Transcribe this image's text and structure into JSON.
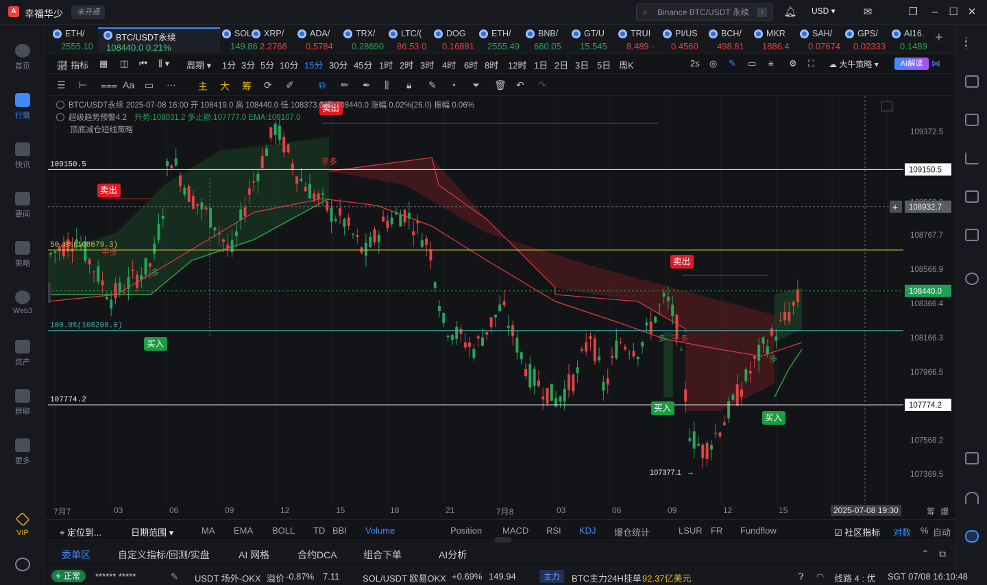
{
  "titlebar": {
    "app_title": "幸福华少",
    "login_status": "未开通",
    "search_placeholder": "Binance BTC/USDT 永续",
    "search_kbd": "/",
    "currency": "USD"
  },
  "leftnav": {
    "items": [
      {
        "label": "首页",
        "icon": "home-icon",
        "active": false
      },
      {
        "label": "行情",
        "icon": "chart-icon",
        "active": true
      },
      {
        "label": "快讯",
        "icon": "news-icon",
        "active": false
      },
      {
        "label": "要闻",
        "icon": "article-icon",
        "active": false
      },
      {
        "label": "策略",
        "icon": "robot-icon",
        "active": false
      },
      {
        "label": "Web3",
        "icon": "web3-icon",
        "active": false
      },
      {
        "label": "资产",
        "icon": "wallet-icon",
        "active": false
      },
      {
        "label": "群聊",
        "icon": "chat-icon",
        "active": false
      },
      {
        "label": "更多",
        "icon": "grid-icon",
        "active": false
      }
    ],
    "vip": "VIP"
  },
  "tickers": [
    {
      "sym": "ETH/",
      "price": "2555.10",
      "dir": "up"
    },
    {
      "sym": "BTC/USDT永续",
      "price": "108440.0  0.21%",
      "dir": "up",
      "active": true
    },
    {
      "sym": "SOL/",
      "price": "149.86",
      "dir": "up"
    },
    {
      "sym": "XRP/",
      "price": "2.2768",
      "dir": "dn"
    },
    {
      "sym": "ADA/",
      "price": "0.5784",
      "dir": "dn"
    },
    {
      "sym": "TRX/",
      "price": "0.28690",
      "dir": "up"
    },
    {
      "sym": "LTC/(",
      "price": "86.53  0",
      "dir": "dn"
    },
    {
      "sym": "DOG",
      "price": "0.16881",
      "dir": "dn"
    },
    {
      "sym": "ETH/",
      "price": "2555.49",
      "dir": "up"
    },
    {
      "sym": "BNB/",
      "price": "660.05",
      "dir": "up"
    },
    {
      "sym": "GT/U",
      "price": "15.545",
      "dir": "up"
    },
    {
      "sym": "TRUI",
      "price": "8.489  -",
      "dir": "dn"
    },
    {
      "sym": "PI/US",
      "price": "0.4560",
      "dir": "dn"
    },
    {
      "sym": "BCH/",
      "price": "498.81",
      "dir": "dn"
    },
    {
      "sym": "MKR",
      "price": "1886.4",
      "dir": "dn"
    },
    {
      "sym": "SAH/",
      "price": "0.07674",
      "dir": "dn"
    },
    {
      "sym": "GPS/",
      "price": "0.02333",
      "dir": "dn"
    },
    {
      "sym": "AI16.",
      "price": "0.1489",
      "dir": "up"
    }
  ],
  "intervalbar": {
    "indicator": "指标",
    "period": "周期",
    "intervals": [
      "1分",
      "3分",
      "5分",
      "10分",
      "15分",
      "30分",
      "45分",
      "1时",
      "2时",
      "3时",
      "4时",
      "6时",
      "8时",
      "12时",
      "1日",
      "2日",
      "3日",
      "5日",
      "周K"
    ],
    "selected": "15分",
    "refresh": "2s",
    "strategy": "大牛策略",
    "ai_button": "AI解读"
  },
  "drawbar": {
    "tools": [
      "主",
      "大",
      "筹"
    ]
  },
  "chart_info": {
    "line1": "BTC/USDT永续 2025-07-08 16:00  开 108419.0  高 108440.0  低 108373.0  收 108440.0  涨幅 0.02%(26.0)  振幅 0.06%",
    "line2_name": "超级趋势预警4.2",
    "line2_values": "升势:108031.2  多止损:107777.0  EMA:108107.0",
    "line3": "顶底减仓短线策略"
  },
  "chart_data": {
    "type": "candlestick",
    "yticks": [
      "109372.5",
      "109150.5",
      "108960.0",
      "108767.7",
      "108566.9",
      "108366.4",
      "108166.3",
      "107966.5",
      "107774.2",
      "107568.2",
      "107369.5"
    ],
    "price_tags": [
      {
        "value": "109150.5",
        "style": "white"
      },
      {
        "value": "108932.7",
        "style": "crosshair"
      },
      {
        "value": "108440.0",
        "style": "current"
      },
      {
        "value": "107774.2",
        "style": "white"
      }
    ],
    "hlines": [
      {
        "label": "109150.5",
        "value": 109150.5
      },
      {
        "label": "107774.2",
        "value": 107774.2
      }
    ],
    "fib": [
      {
        "label": "50.0%(108679.3)",
        "value": 108679.3
      },
      {
        "label": "100.0%(108208.0)",
        "value": 108208.0
      }
    ],
    "signals": [
      {
        "text": "卖出",
        "type": "sell"
      },
      {
        "text": "卖出",
        "type": "sell"
      },
      {
        "text": "卖出",
        "type": "sell"
      },
      {
        "text": "买入",
        "type": "buy"
      },
      {
        "text": "买入",
        "type": "buy"
      },
      {
        "text": "买入",
        "type": "buy"
      },
      {
        "text": "平多",
        "type": "close"
      },
      {
        "text": "平多",
        "type": "close"
      },
      {
        "text": "平多",
        "type": "close"
      },
      {
        "text": "多",
        "type": "long"
      },
      {
        "text": "多",
        "type": "long"
      },
      {
        "text": "多",
        "type": "long"
      }
    ],
    "low_label": "107377.1",
    "xticks": [
      "7月7",
      "03",
      "06",
      "09",
      "12",
      "15",
      "18",
      "21",
      "7月8",
      "03",
      "06",
      "09",
      "12",
      "15"
    ],
    "crosshair_time": "2025-07-08 19:30",
    "corner": [
      "筹",
      "爆"
    ]
  },
  "indbar": {
    "locate": "定位到...",
    "range": "日期范围",
    "items": [
      "MA",
      "EMA",
      "BOLL",
      "TD",
      "BBI",
      "Volume",
      "Position",
      "MACD",
      "RSI",
      "KDJ",
      "爆仓统计",
      "LSUR",
      "FR",
      "Fundflow"
    ],
    "selected": [
      "Volume",
      "KDJ"
    ],
    "community": "社区指标",
    "log": "对数",
    "pct": "%",
    "auto": "自动"
  },
  "ordertabs": {
    "items": [
      "委单区",
      "自定义指标/回测/实盘",
      "AI 网格",
      "合约DCA",
      "组合下单",
      "AI分析"
    ],
    "selected": "委单区"
  },
  "statusbar": {
    "ok": "正常",
    "mask": "******  *****",
    "usdt_label": "USDT 场外-OKX",
    "premium_label": "溢价",
    "premium": "-0.87%",
    "usdt_price": "7.11",
    "sol_label": "SOL/USDT 欧易OKX",
    "sol_change": "+0.69%",
    "sol_price": "149.94",
    "main_tag": "主力",
    "btc_main": "BTC主力24H挂单",
    "btc_main_val": "92.37亿美元",
    "line": "线路 4 : 优",
    "clock": "SGT 07/08 16:10:48"
  }
}
